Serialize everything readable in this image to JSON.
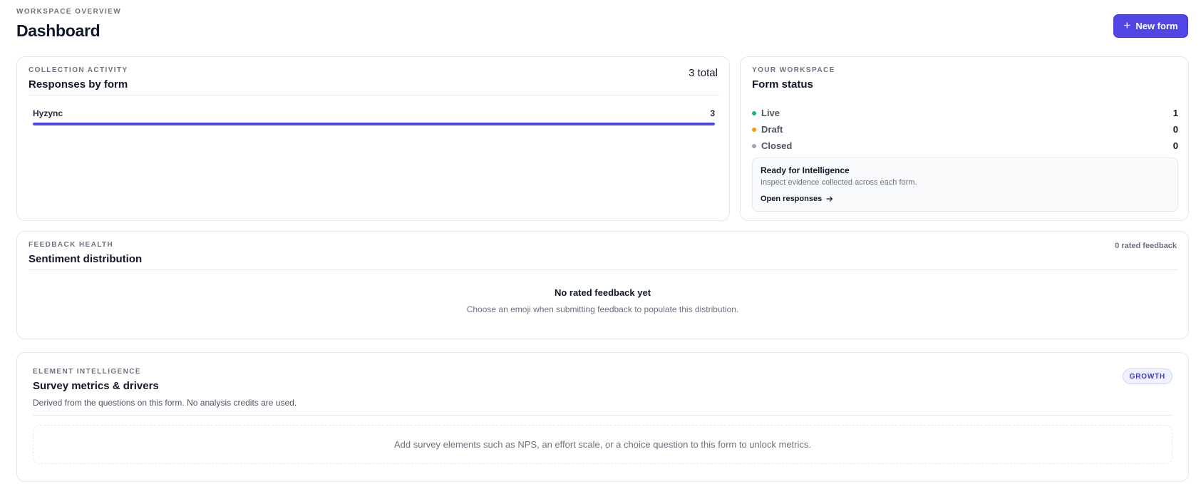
{
  "header": {
    "eyebrow": "WORKSPACE OVERVIEW",
    "title": "Dashboard",
    "new_form_label": "New form"
  },
  "responses": {
    "eyebrow": "COLLECTION ACTIVITY",
    "title": "Responses by form",
    "total": "3 total",
    "forms": [
      {
        "name": "Hyzync",
        "count": "3",
        "fill": 1.0
      }
    ]
  },
  "status": {
    "eyebrow": "YOUR WORKSPACE",
    "title": "Form status",
    "items": [
      {
        "label": "Live",
        "value": "1",
        "color": "#10b981"
      },
      {
        "label": "Draft",
        "value": "0",
        "color": "#f59e0b"
      },
      {
        "label": "Closed",
        "value": "0",
        "color": "#9ca3af"
      }
    ],
    "intel": {
      "title": "Ready for Intelligence",
      "desc": "Inspect evidence collected across each form.",
      "link": "Open responses"
    }
  },
  "sentiment": {
    "eyebrow": "FEEDBACK HEALTH",
    "title": "Sentiment distribution",
    "rated_count": "0 rated feedback",
    "empty_title": "No rated feedback yet",
    "empty_desc": "Choose an emoji when submitting feedback to populate this distribution."
  },
  "metrics": {
    "eyebrow": "ELEMENT INTELLIGENCE",
    "title": "Survey metrics & drivers",
    "desc": "Derived from the questions on this form. No analysis credits are used.",
    "badge": "GROWTH",
    "empty": "Add survey elements such as NPS, an effort scale, or a choice question to this form to unlock metrics."
  },
  "colors": {
    "accent": "#4f46e5"
  }
}
